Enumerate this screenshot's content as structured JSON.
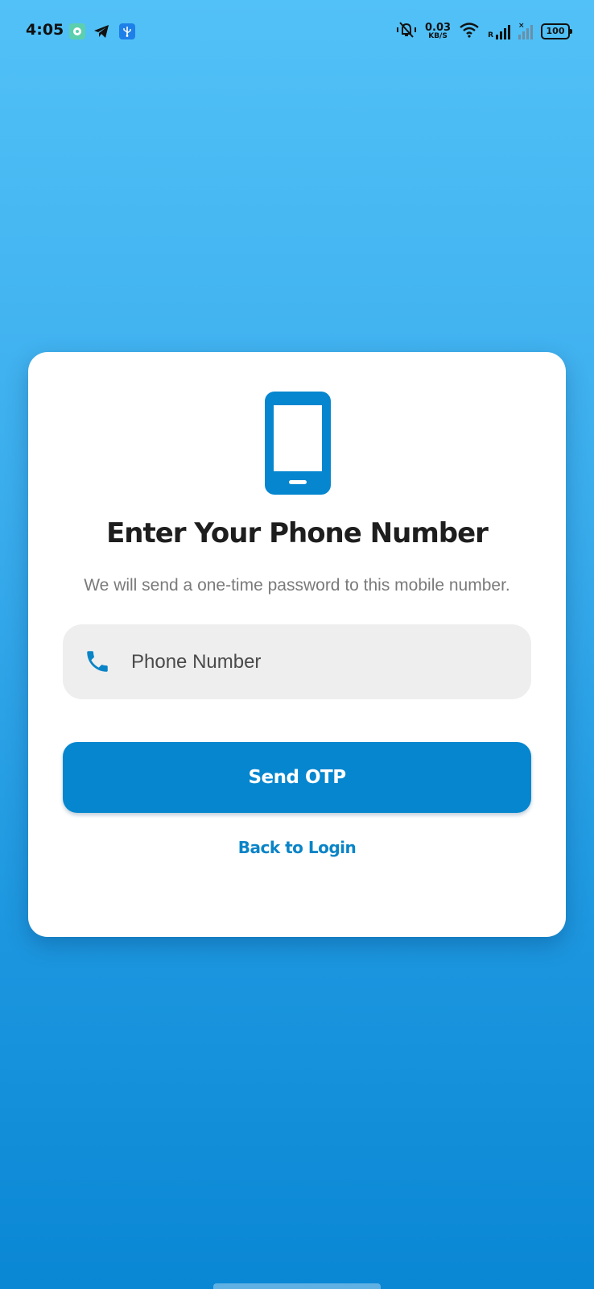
{
  "status_bar": {
    "time": "4:05",
    "app_icons": [
      "chat-bubble-icon",
      "telegram-icon",
      "usb-icon"
    ],
    "net_speed_value": "0.03",
    "net_speed_unit": "KB/S",
    "roaming_label": "R",
    "battery_level": "100"
  },
  "card": {
    "title": "Enter Your Phone Number",
    "subtitle": "We will send a one-time password to this mobile number.",
    "phone_field": {
      "placeholder": "Phone Number",
      "value": ""
    },
    "send_button_label": "Send OTP",
    "back_link_label": "Back to Login"
  },
  "colors": {
    "accent": "#0586cf",
    "background_top": "#52c1f7",
    "background_bottom": "#0a87d4",
    "title_text": "#1e1e1e",
    "subtitle_text": "#7a7a7a",
    "field_background": "#eeeeee"
  }
}
